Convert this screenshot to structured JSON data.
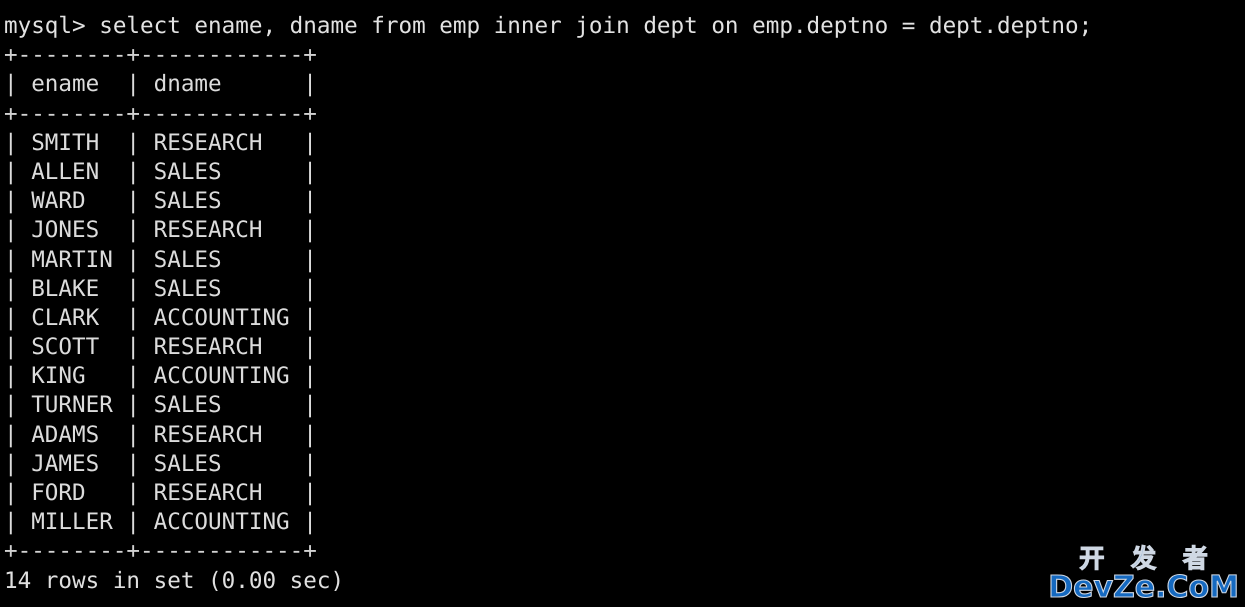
{
  "terminal": {
    "prompt": "mysql> ",
    "command": "select ename, dname from emp inner join dept on emp.deptno = dept.deptno;",
    "prompt_line": "mysql> select ename, dname from emp inner join dept on emp.deptno = dept.deptno;",
    "top_rule": "+--------+------------+",
    "header_rule": "+--------+------------+",
    "bottom_rule": "+--------+------------+",
    "header_line": "| ename  | dname      |",
    "columns": [
      "ename",
      "dname"
    ],
    "rows": [
      {
        "ename": "SMITH",
        "dname": "RESEARCH",
        "line": "| SMITH  | RESEARCH   |"
      },
      {
        "ename": "ALLEN",
        "dname": "SALES",
        "line": "| ALLEN  | SALES      |"
      },
      {
        "ename": "WARD",
        "dname": "SALES",
        "line": "| WARD   | SALES      |"
      },
      {
        "ename": "JONES",
        "dname": "RESEARCH",
        "line": "| JONES  | RESEARCH   |"
      },
      {
        "ename": "MARTIN",
        "dname": "SALES",
        "line": "| MARTIN | SALES      |"
      },
      {
        "ename": "BLAKE",
        "dname": "SALES",
        "line": "| BLAKE  | SALES      |"
      },
      {
        "ename": "CLARK",
        "dname": "ACCOUNTING",
        "line": "| CLARK  | ACCOUNTING |"
      },
      {
        "ename": "SCOTT",
        "dname": "RESEARCH",
        "line": "| SCOTT  | RESEARCH   |"
      },
      {
        "ename": "KING",
        "dname": "ACCOUNTING",
        "line": "| KING   | ACCOUNTING |"
      },
      {
        "ename": "TURNER",
        "dname": "SALES",
        "line": "| TURNER | SALES      |"
      },
      {
        "ename": "ADAMS",
        "dname": "RESEARCH",
        "line": "| ADAMS  | RESEARCH   |"
      },
      {
        "ename": "JAMES",
        "dname": "SALES",
        "line": "| JAMES  | SALES      |"
      },
      {
        "ename": "FORD",
        "dname": "RESEARCH",
        "line": "| FORD   | RESEARCH   |"
      },
      {
        "ename": "MILLER",
        "dname": "ACCOUNTING",
        "line": "| MILLER | ACCOUNTING |"
      }
    ],
    "row_count": 14,
    "status": "14 rows in set (0.00 sec)",
    "colors": {
      "background": "#000000",
      "foreground": "#dcdcdc"
    }
  },
  "watermark": {
    "chinese": "开 发 者",
    "latin": "DevZe.CoM",
    "color": "#1569c0"
  }
}
